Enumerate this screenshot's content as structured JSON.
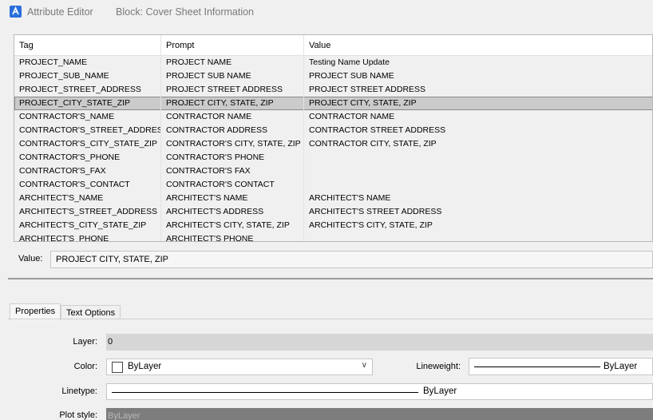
{
  "window": {
    "title": "Attribute Editor",
    "block_label": "Block: Cover Sheet Information",
    "icon": "app-logo-icon"
  },
  "grid": {
    "columns": [
      "Tag",
      "Prompt",
      "Value"
    ],
    "selected_index": 3,
    "rows": [
      {
        "tag": "PROJECT_NAME",
        "prompt": "PROJECT NAME",
        "value": "Testing Name Update"
      },
      {
        "tag": "PROJECT_SUB_NAME",
        "prompt": "PROJECT SUB NAME",
        "value": "PROJECT SUB NAME"
      },
      {
        "tag": "PROJECT_STREET_ADDRESS",
        "prompt": "PROJECT STREET ADDRESS",
        "value": "PROJECT STREET ADDRESS"
      },
      {
        "tag": "PROJECT_CITY_STATE_ZIP",
        "prompt": "PROJECT CITY, STATE, ZIP",
        "value": "PROJECT CITY, STATE, ZIP"
      },
      {
        "tag": "CONTRACTOR'S_NAME",
        "prompt": "CONTRACTOR NAME",
        "value": "CONTRACTOR NAME"
      },
      {
        "tag": "CONTRACTOR'S_STREET_ADDRESS",
        "prompt": "CONTRACTOR ADDRESS",
        "value": "CONTRACTOR STREET ADDRESS"
      },
      {
        "tag": "CONTRACTOR'S_CITY_STATE_ZIP",
        "prompt": "CONTRACTOR'S CITY, STATE, ZIP",
        "value": "CONTRACTOR CITY, STATE, ZIP"
      },
      {
        "tag": "CONTRACTOR'S_PHONE",
        "prompt": "CONTRACTOR'S PHONE",
        "value": ""
      },
      {
        "tag": "CONTRACTOR'S_FAX",
        "prompt": "CONTRACTOR'S FAX",
        "value": ""
      },
      {
        "tag": "CONTRACTOR'S_CONTACT",
        "prompt": "CONTRACTOR'S CONTACT",
        "value": ""
      },
      {
        "tag": "ARCHITECT'S_NAME",
        "prompt": "ARCHITECT'S NAME",
        "value": "ARCHITECT'S NAME"
      },
      {
        "tag": "ARCHITECT'S_STREET_ADDRESS",
        "prompt": "ARCHITECT'S ADDRESS",
        "value": "ARCHITECT'S STREET ADDRESS"
      },
      {
        "tag": "ARCHITECT'S_CITY_STATE_ZIP",
        "prompt": "ARCHITECT'S CITY, STATE, ZIP",
        "value": "ARCHITECT'S CITY, STATE, ZIP"
      },
      {
        "tag": "ARCHITECT'S_PHONE",
        "prompt": "ARCHITECT'S PHONE",
        "value": ""
      }
    ]
  },
  "value_field": {
    "label": "Value:",
    "value": "PROJECT CITY, STATE, ZIP"
  },
  "tabs": [
    {
      "label": "Properties",
      "active": true
    },
    {
      "label": "Text Options",
      "active": false
    }
  ],
  "properties": {
    "layer_label": "Layer:",
    "layer_value": "0",
    "color_label": "Color:",
    "color_value": "ByLayer",
    "lineweight_label": "Lineweight:",
    "lineweight_value": "ByLayer",
    "linetype_label": "Linetype:",
    "linetype_value": "ByLayer",
    "plotstyle_label": "Plot style:",
    "plotstyle_value": "ByLayer"
  },
  "colors": {
    "accent": "#2a6fdb",
    "selected_row": "#cbcbcb"
  }
}
